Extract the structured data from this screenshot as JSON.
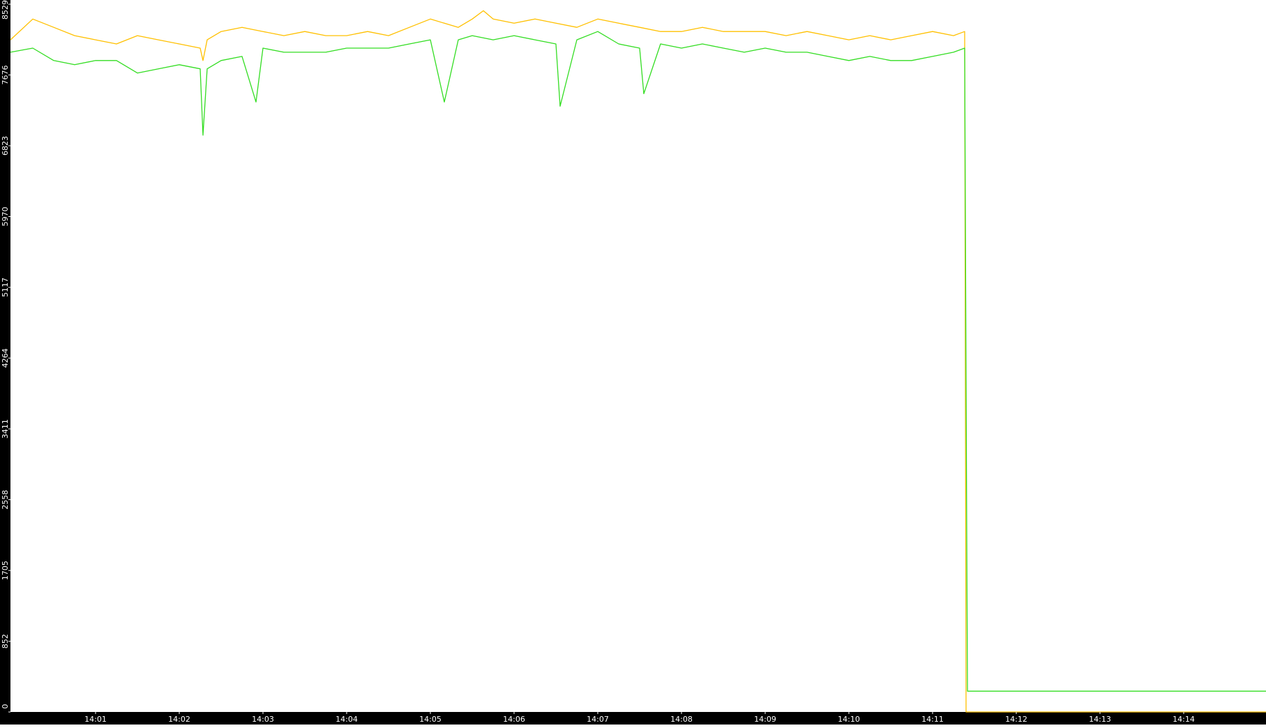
{
  "chart_data": {
    "type": "line",
    "title": "",
    "xlabel": "",
    "ylabel": "",
    "background": "#ffffff",
    "axis_color": "#000000",
    "grid": false,
    "legend": "none",
    "xlim": [
      "13:59:59",
      "14:14:59"
    ],
    "ylim": [
      0,
      8529
    ],
    "x_ticks": [
      "14:01",
      "14:02",
      "14:03",
      "14:04",
      "14:05",
      "14:06",
      "14:07",
      "14:08",
      "14:09",
      "14:10",
      "14:11",
      "14:12",
      "14:13",
      "14:14"
    ],
    "y_ticks": [
      "0",
      "852",
      "1705",
      "2558",
      "3411",
      "4264",
      "5117",
      "5970",
      "6823",
      "7676",
      "8529"
    ],
    "series": [
      {
        "color": "#ffc000",
        "x": [
          "13:59:59",
          "14:00:15",
          "14:00:30",
          "14:00:45",
          "14:01:00",
          "14:01:15",
          "14:01:30",
          "14:01:45",
          "14:02:00",
          "14:02:15",
          "14:02:17",
          "14:02:20",
          "14:02:30",
          "14:02:45",
          "14:03:00",
          "14:03:15",
          "14:03:30",
          "14:03:45",
          "14:04:00",
          "14:04:15",
          "14:04:30",
          "14:04:45",
          "14:05:00",
          "14:05:10",
          "14:05:20",
          "14:05:30",
          "14:05:38",
          "14:05:45",
          "14:06:00",
          "14:06:15",
          "14:06:30",
          "14:06:45",
          "14:07:00",
          "14:07:15",
          "14:07:30",
          "14:07:45",
          "14:08:00",
          "14:08:15",
          "14:08:30",
          "14:08:45",
          "14:09:00",
          "14:09:15",
          "14:09:30",
          "14:09:45",
          "14:10:00",
          "14:10:15",
          "14:10:30",
          "14:10:45",
          "14:11:00",
          "14:11:15",
          "14:11:23",
          "14:11:24",
          "14:14:59"
        ],
        "y": [
          8100,
          8350,
          8250,
          8150,
          8100,
          8050,
          8150,
          8100,
          8050,
          8000,
          7850,
          8100,
          8200,
          8250,
          8200,
          8150,
          8200,
          8150,
          8150,
          8200,
          8150,
          8250,
          8350,
          8300,
          8250,
          8350,
          8450,
          8350,
          8300,
          8350,
          8300,
          8250,
          8350,
          8300,
          8250,
          8200,
          8200,
          8250,
          8200,
          8200,
          8200,
          8150,
          8200,
          8150,
          8100,
          8150,
          8100,
          8150,
          8200,
          8150,
          8200,
          0,
          0
        ]
      },
      {
        "color": "#33dd22",
        "x": [
          "13:59:59",
          "14:00:15",
          "14:00:30",
          "14:00:45",
          "14:01:00",
          "14:01:15",
          "14:01:30",
          "14:01:45",
          "14:02:00",
          "14:02:15",
          "14:02:17",
          "14:02:20",
          "14:02:30",
          "14:02:45",
          "14:02:55",
          "14:03:00",
          "14:03:15",
          "14:03:30",
          "14:03:45",
          "14:04:00",
          "14:04:15",
          "14:04:30",
          "14:04:45",
          "14:05:00",
          "14:05:10",
          "14:05:20",
          "14:05:30",
          "14:05:45",
          "14:06:00",
          "14:06:15",
          "14:06:30",
          "14:06:33",
          "14:06:45",
          "14:07:00",
          "14:07:15",
          "14:07:30",
          "14:07:33",
          "14:07:45",
          "14:08:00",
          "14:08:15",
          "14:08:30",
          "14:08:45",
          "14:09:00",
          "14:09:15",
          "14:09:30",
          "14:09:45",
          "14:10:00",
          "14:10:15",
          "14:10:30",
          "14:10:45",
          "14:11:00",
          "14:11:15",
          "14:11:23",
          "14:11:24",
          "14:11:25",
          "14:14:59"
        ],
        "y": [
          7950,
          8000,
          7850,
          7800,
          7850,
          7850,
          7700,
          7750,
          7800,
          7750,
          6950,
          7750,
          7850,
          7900,
          7350,
          8000,
          7950,
          7950,
          7950,
          8000,
          8000,
          8000,
          8050,
          8100,
          7350,
          8100,
          8150,
          8100,
          8150,
          8100,
          8050,
          7300,
          8100,
          8200,
          8050,
          8000,
          7450,
          8050,
          8000,
          8050,
          8000,
          7950,
          8000,
          7950,
          7950,
          7900,
          7850,
          7900,
          7850,
          7850,
          7900,
          7950,
          8000,
          4000,
          250,
          250
        ]
      }
    ]
  }
}
